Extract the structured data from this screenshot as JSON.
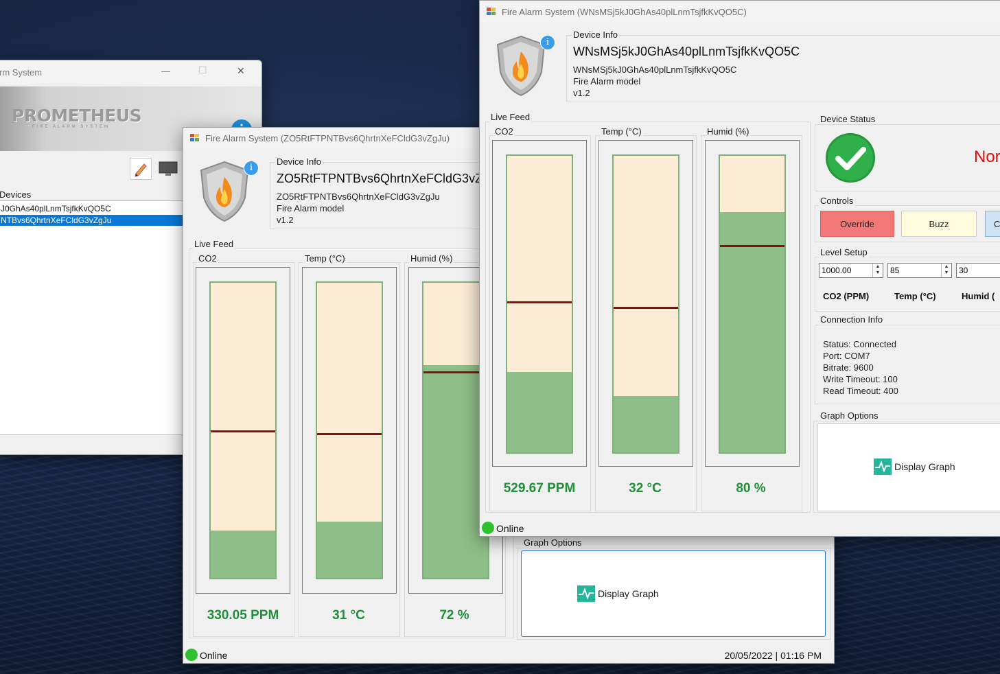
{
  "windows": {
    "main": {
      "title": "rm System",
      "brand": "PROMETHEUS",
      "brand_sub": "FIRE ALARM SYSTEM",
      "devices_label": "Devices",
      "devices": [
        "J0GhAs40plLnmTsjfkKvQO5C",
        "NTBvs6QhrtnXeFCldG3vZgJu"
      ],
      "selected_index": 1,
      "controls": {
        "minimize": "—",
        "maximize": "☐",
        "close": "✕"
      }
    },
    "device1": {
      "title": "Fire Alarm System (ZO5RtFTPNTBvs6QhrtnXeFCldG3vZgJu)",
      "device_info_label": "Device Info",
      "device_name": "ZO5RtFTPNTBvs6QhrtnXeFCldG3vZgJu",
      "device_id": "ZO5RtFTPNTBvs6QhrtnXeFCldG3vZgJu",
      "model": "Fire Alarm model",
      "version": "v1.2",
      "live_feed_label": "Live Feed",
      "co2_label": "CO2",
      "temp_label": "Temp (°C)",
      "humid_label": "Humid (%)",
      "co2_reading": "330.05 PPM",
      "temp_reading": "31 °C",
      "humid_reading": "72 %",
      "levels": {
        "co2_fill": 0.16,
        "co2_thresh": 0.5,
        "temp_fill": 0.19,
        "temp_thresh": 0.51,
        "humid_fill": 0.72,
        "humid_thresh": 0.3
      },
      "graph_options_label": "Graph Options",
      "display_graph": "Display Graph",
      "status": "Online",
      "datetime": "20/05/2022 | 01:16 PM"
    },
    "device2": {
      "title": "Fire Alarm System (WNsMSj5kJ0GhAs40plLnmTsjfkKvQO5C)",
      "device_info_label": "Device Info",
      "device_name": "WNsMSj5kJ0GhAs40plLnmTsjfkKvQO5C",
      "device_id": "WNsMSj5kJ0GhAs40plLnmTsjfkKvQO5C",
      "model": "Fire Alarm model",
      "version": "v1.2",
      "live_feed_label": "Live Feed",
      "co2_label": "CO2",
      "temp_label": "Temp (°C)",
      "humid_label": "Humid (%)",
      "co2_reading": "529.67 PPM",
      "temp_reading": "32 °C",
      "humid_reading": "80 %",
      "levels": {
        "co2_fill": 0.27,
        "co2_thresh": 0.49,
        "temp_fill": 0.19,
        "temp_thresh": 0.51,
        "humid_fill": 0.81,
        "humid_thresh": 0.3
      },
      "device_status_label": "Device Status",
      "status_text": "Nor",
      "controls_label": "Controls",
      "override_label": "Override",
      "buzz_label": "Buzz",
      "third_button_label": "C",
      "level_setup_label": "Level Setup",
      "co2_setpoint": "1000.00",
      "temp_setpoint": "85",
      "humid_setpoint": "30",
      "co2_unit_label": "CO2 (PPM)",
      "temp_unit_label": "Temp (°C)",
      "humid_unit_label": "Humid (",
      "connection_info_label": "Connection Info",
      "connection": {
        "status": "Status: Connected",
        "port": "Port: COM7",
        "bitrate": "Bitrate: 9600",
        "write_timeout": "Write Timeout: 100",
        "read_timeout": "Read Timeout: 400"
      },
      "graph_options_label": "Graph Options",
      "display_graph": "Display Graph",
      "status": "Online"
    }
  },
  "colors": {
    "override": "#f27878",
    "buzz": "#fffbdc",
    "reading": "#1f8f3a",
    "selection": "#0a78d7",
    "status_red": "#e01010"
  }
}
